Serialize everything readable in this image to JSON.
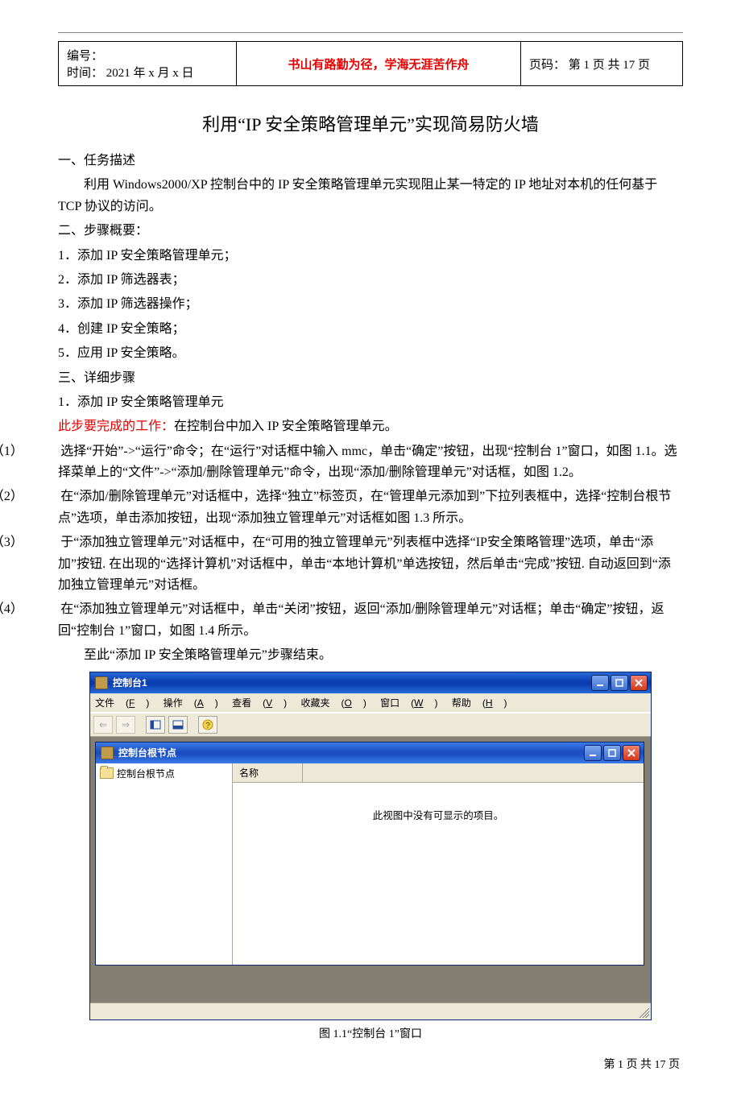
{
  "header": {
    "serial_label": "编号：",
    "serial_value": "",
    "time_label": "时间：",
    "time_value": "2021 年 x 月 x 日",
    "motto": "书山有路勤为径，学海无涯苦作舟",
    "page_label": "页码：",
    "page_value": "第 1 页 共 17 页"
  },
  "title": "利用“IP 安全策略管理单元”实现简易防火墙",
  "section1": {
    "heading": "一、任务描述",
    "para": "利用 Windows2000/XP 控制台中的 IP 安全策略管理单元实现阻止某一特定的 IP 地址对本机的任何基于 TCP 协议的访问。"
  },
  "section2": {
    "heading": "二、步骤概要：",
    "items": [
      "1．添加 IP 安全策略管理单元；",
      "2．添加 IP 筛选器表；",
      "3．添加 IP 筛选器操作；",
      "4．创建 IP 安全策略；",
      "5．应用 IP 安全策略。"
    ]
  },
  "section3": {
    "heading": "三、详细步骤",
    "step1_title": "1．添加 IP 安全策略管理单元",
    "red_prefix": "此步要完成的工作：",
    "red_rest": "在控制台中加入 IP 安全策略管理单元。",
    "subs": [
      {
        "n": "（1）",
        "t": "选择“开始”->“运行”命令；在“运行”对话框中输入 mmc，单击“确定”按钮，出现“控制台 1”窗口，如图 1.1。选择菜单上的“文件”->“添加/删除管理单元”命令，出现“添加/删除管理单元”对话框，如图 1.2。"
      },
      {
        "n": "（2）",
        "t": "在“添加/删除管理单元”对话框中，选择“独立”标签页，在“管理单元添加到”下拉列表框中，选择“控制台根节点”选项，单击添加按钮，出现“添加独立管理单元”对话框如图 1.3 所示。"
      },
      {
        "n": "（3）",
        "t": "于“添加独立管理单元”对话框中，在“可用的独立管理单元”列表框中选择“IP安全策略管理”选项，单击“添加”按钮. 在出现的“选择计算机”对话框中，单击“本地计算机”单选按钮，然后单击“完成”按钮. 自动返回到“添加独立管理单元”对话框。"
      },
      {
        "n": "（4）",
        "t": "在“添加独立管理单元”对话框中，单击“关闭”按钮，返回“添加/删除管理单元”对话框；单击“确定”按钮，返回“控制台 1”窗口，如图 1.4 所示。"
      }
    ],
    "end_line": "至此“添加 IP 安全策略管理单元”步骤结束。"
  },
  "screenshot": {
    "outer_title": "控制台1",
    "menus": [
      {
        "t": "文件",
        "a": "F"
      },
      {
        "t": "操作",
        "a": "A"
      },
      {
        "t": "查看",
        "a": "V"
      },
      {
        "t": "收藏夹",
        "a": "O"
      },
      {
        "t": "窗口",
        "a": "W"
      },
      {
        "t": "帮助",
        "a": "H"
      }
    ],
    "child_title": "控制台根节点",
    "tree_root": "控制台根节点",
    "col_name": "名称",
    "empty_msg": "此视图中没有可显示的项目。"
  },
  "fig_caption": "图 1.1“控制台 1”窗口",
  "footer": "第 1 页 共 17 页"
}
